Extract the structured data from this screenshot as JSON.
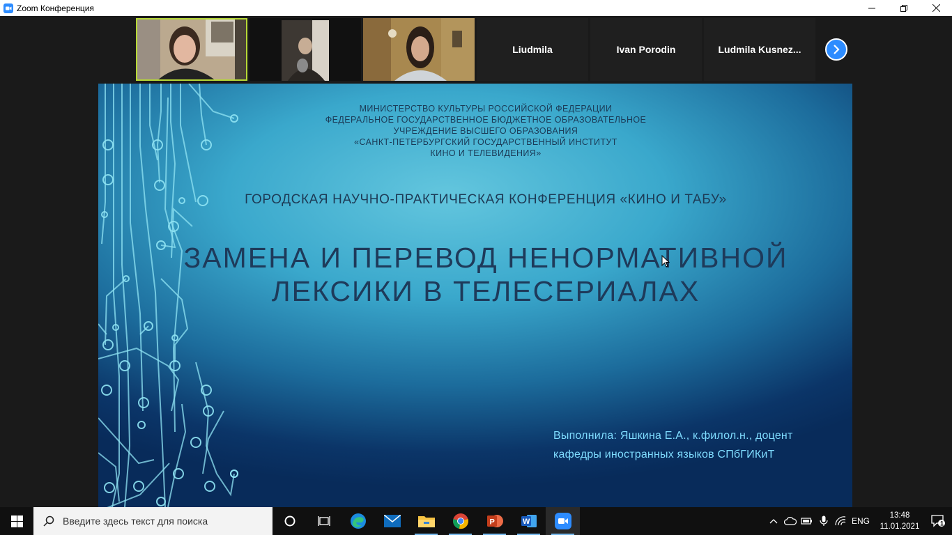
{
  "window": {
    "title": "Zoom Конференция",
    "controls": [
      "minimize-icon",
      "restore-icon",
      "close-icon"
    ]
  },
  "participants": [
    {
      "type": "video",
      "active": true
    },
    {
      "type": "video",
      "active": false
    },
    {
      "type": "video",
      "active": false
    },
    {
      "type": "name",
      "name": "Liudmila"
    },
    {
      "type": "name",
      "name": "Ivan Porodin"
    },
    {
      "type": "name",
      "name": "Ludmila  Kusnez..."
    }
  ],
  "slide": {
    "ministry_lines": [
      "МИНИСТЕРСТВО КУЛЬТУРЫ РОССИЙСКОЙ ФЕДЕРАЦИИ",
      "ФЕДЕРАЛЬНОЕ ГОСУДАРСТВЕННОЕ БЮДЖЕТНОЕ ОБРАЗОВАТЕЛЬНОЕ",
      "УЧРЕЖДЕНИЕ ВЫСШЕГО ОБРАЗОВАНИЯ",
      "«САНКТ-ПЕТЕРБУРГСКИЙ ГОСУДАРСТВЕННЫЙ ИНСТИТУТ",
      "КИНО И ТЕЛЕВИДЕНИЯ»"
    ],
    "conference": "ГОРОДСКАЯ НАУЧНО-ПРАКТИЧЕСКАЯ КОНФЕРЕНЦИЯ «КИНО И ТАБУ»",
    "title_line1": "ЗАМЕНА И ПЕРЕВОД НЕНОРМАТИВНОЙ",
    "title_line2": "ЛЕКСИКИ В ТЕЛЕСЕРИАЛАХ",
    "author_line1": "Выполнила: Яшкина Е.А., к.филол.н., доцент",
    "author_line2": "кафедры иностранных языков СПбГИКиТ"
  },
  "taskbar": {
    "search_placeholder": "Введите здесь текст для поиска",
    "apps": [
      "cortana-icon",
      "task-view-icon",
      "edge-icon",
      "mail-icon",
      "file-explorer-icon",
      "chrome-icon",
      "powerpoint-icon",
      "word-icon",
      "zoom-icon"
    ],
    "language": "ENG",
    "time": "13:48",
    "date": "11.01.2021",
    "notification_count": "1"
  },
  "colors": {
    "zoom_blue": "#2d8cff",
    "active_speaker": "#b7d936",
    "author_text": "#7fdcff"
  }
}
